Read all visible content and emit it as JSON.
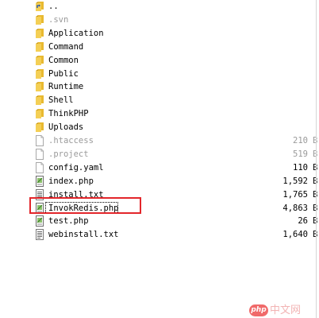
{
  "files": [
    {
      "name": "..",
      "icon": "up-folder-icon",
      "kind": "parent-dir",
      "dim": false
    },
    {
      "name": ".svn",
      "icon": "folder-icon",
      "kind": "folder",
      "dim": true
    },
    {
      "name": "Application",
      "icon": "folder-icon",
      "kind": "folder",
      "dim": false
    },
    {
      "name": "Command",
      "icon": "folder-icon",
      "kind": "folder",
      "dim": false
    },
    {
      "name": "Common",
      "icon": "folder-icon",
      "kind": "folder",
      "dim": false
    },
    {
      "name": "Public",
      "icon": "folder-icon",
      "kind": "folder",
      "dim": false
    },
    {
      "name": "Runtime",
      "icon": "folder-icon",
      "kind": "folder",
      "dim": false
    },
    {
      "name": "Shell",
      "icon": "folder-icon",
      "kind": "folder",
      "dim": false
    },
    {
      "name": "ThinkPHP",
      "icon": "folder-icon",
      "kind": "folder",
      "dim": false
    },
    {
      "name": "Uploads",
      "icon": "folder-icon",
      "kind": "folder",
      "dim": false
    },
    {
      "name": ".htaccess",
      "icon": "file-icon",
      "kind": "file",
      "dim": true,
      "size": "210",
      "unit": "B"
    },
    {
      "name": ".project",
      "icon": "file-icon",
      "kind": "file",
      "dim": true,
      "size": "519",
      "unit": "B"
    },
    {
      "name": "config.yaml",
      "icon": "file-icon",
      "kind": "file",
      "dim": false,
      "size": "110",
      "unit": "B"
    },
    {
      "name": "index.php",
      "icon": "php-file-icon",
      "kind": "php",
      "dim": false,
      "size": "1,592",
      "unit": "B"
    },
    {
      "name": "install.txt",
      "icon": "text-file-icon",
      "kind": "text",
      "dim": false,
      "size": "1,765",
      "unit": "B"
    },
    {
      "name": "InvokRedis.php",
      "icon": "php-file-icon",
      "kind": "php",
      "dim": false,
      "size": "4,863",
      "unit": "B",
      "selected": true
    },
    {
      "name": "test.php",
      "icon": "php-file-icon",
      "kind": "php",
      "dim": false,
      "size": "26",
      "unit": "B"
    },
    {
      "name": "webinstall.txt",
      "icon": "text-file-icon",
      "kind": "text",
      "dim": false,
      "size": "1,640",
      "unit": "B"
    }
  ],
  "highlight_color": "#e3262b",
  "folder_color": "#e8b930",
  "watermark": {
    "logo_text": "php",
    "site_text": "中文网",
    "logo_color": "#f06a6a"
  }
}
